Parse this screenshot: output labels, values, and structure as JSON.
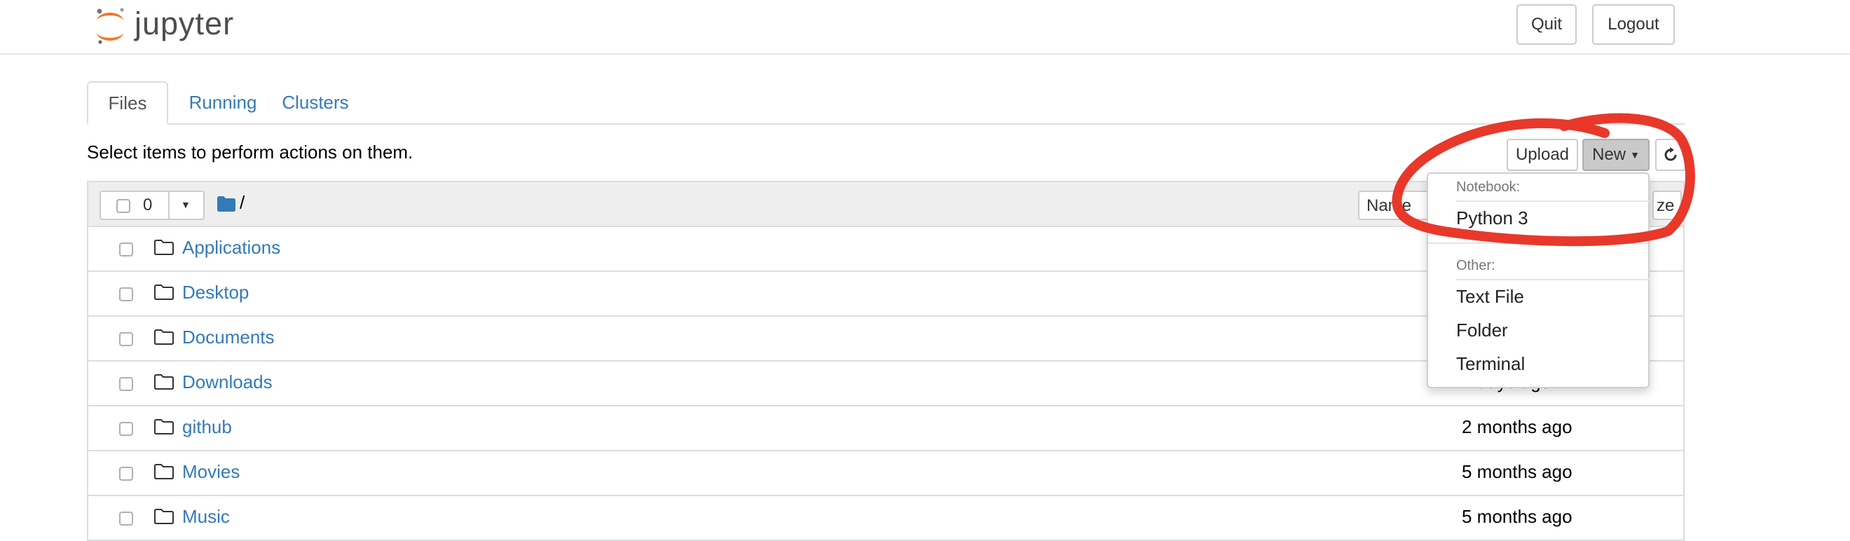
{
  "header": {
    "logo_text": "jupyter",
    "quit_label": "Quit",
    "logout_label": "Logout"
  },
  "tabs": [
    {
      "label": "Files",
      "active": true
    },
    {
      "label": "Running",
      "active": false
    },
    {
      "label": "Clusters",
      "active": false
    }
  ],
  "toolbar": {
    "helper_text": "Select items to perform actions on them.",
    "upload_label": "Upload",
    "new_label": "New"
  },
  "list_header": {
    "selected_count": "0",
    "breadcrumb": "/",
    "sort_name_label": "Name",
    "sort_size_label": "ze"
  },
  "rows": [
    {
      "name": "Applications",
      "modified": ""
    },
    {
      "name": "Desktop",
      "modified": ""
    },
    {
      "name": "Documents",
      "modified": ""
    },
    {
      "name": "Downloads",
      "modified": "4 days ago"
    },
    {
      "name": "github",
      "modified": "2 months ago"
    },
    {
      "name": "Movies",
      "modified": "5 months ago"
    },
    {
      "name": "Music",
      "modified": "5 months ago"
    }
  ],
  "new_menu": {
    "notebook_header": "Notebook:",
    "python_label": "Python 3",
    "other_header": "Other:",
    "text_file_label": "Text File",
    "folder_label": "Folder",
    "terminal_label": "Terminal"
  },
  "colors": {
    "link": "#337ab7",
    "logo_orange": "#f37726",
    "annotation_red": "#e8382a"
  }
}
